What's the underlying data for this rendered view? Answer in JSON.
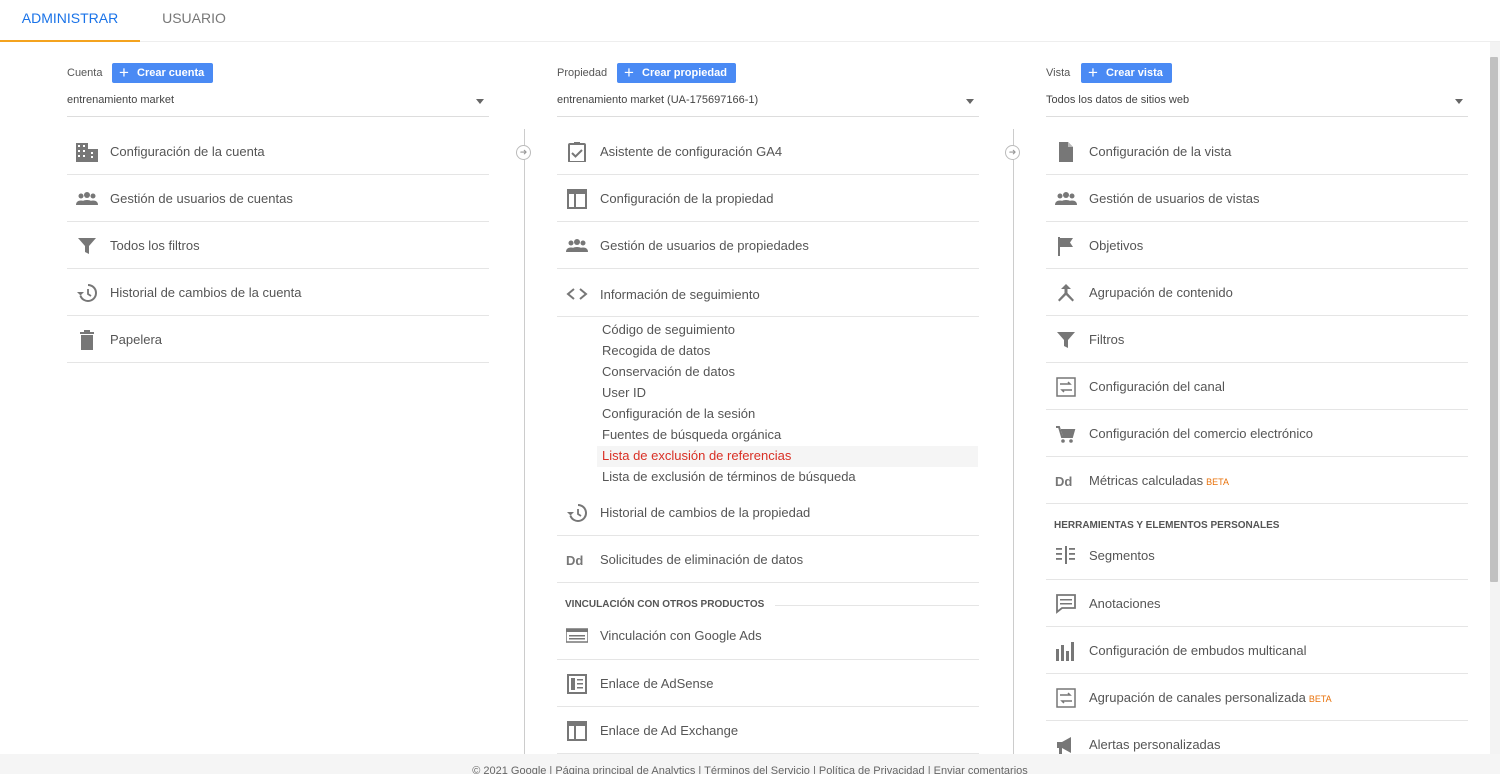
{
  "tabs": {
    "admin": "ADMINISTRAR",
    "user": "USUARIO"
  },
  "account": {
    "label": "Cuenta",
    "create": "Crear cuenta",
    "selected": "entrenamiento market",
    "items": [
      {
        "label": "Configuración de la cuenta",
        "icon": "building-icon"
      },
      {
        "label": "Gestión de usuarios de cuentas",
        "icon": "people-icon"
      },
      {
        "label": "Todos los filtros",
        "icon": "filter-icon"
      },
      {
        "label": "Historial de cambios de la cuenta",
        "icon": "history-icon"
      },
      {
        "label": "Papelera",
        "icon": "trash-icon"
      }
    ]
  },
  "property": {
    "label": "Propiedad",
    "create": "Crear propiedad",
    "selected": "entrenamiento market (UA-175697166-1)",
    "items": [
      {
        "label": "Asistente de configuración GA4",
        "icon": "clipboard-check-icon"
      },
      {
        "label": "Configuración de la propiedad",
        "icon": "window-icon"
      },
      {
        "label": "Gestión de usuarios de propiedades",
        "icon": "people-icon"
      },
      {
        "label": "Información de seguimiento",
        "icon": "code-icon"
      }
    ],
    "tracking_sub": [
      "Código de seguimiento",
      "Recogida de datos",
      "Conservación de datos",
      "User ID",
      "Configuración de la sesión",
      "Fuentes de búsqueda orgánica",
      "Lista de exclusión de referencias",
      "Lista de exclusión de términos de búsqueda"
    ],
    "items2": [
      {
        "label": "Historial de cambios de la propiedad",
        "icon": "history-icon"
      },
      {
        "label": "Solicitudes de eliminación de datos",
        "icon": "dd-icon"
      }
    ],
    "section": "VINCULACIÓN CON OTROS PRODUCTOS",
    "links": [
      {
        "label": "Vinculación con Google Ads",
        "icon": "ads-icon"
      },
      {
        "label": "Enlace de AdSense",
        "icon": "adsense-icon"
      },
      {
        "label": "Enlace de Ad Exchange",
        "icon": "window-icon"
      }
    ]
  },
  "view": {
    "label": "Vista",
    "create": "Crear vista",
    "selected": "Todos los datos de sitios web",
    "items": [
      {
        "label": "Configuración de la vista",
        "icon": "document-icon"
      },
      {
        "label": "Gestión de usuarios de vistas",
        "icon": "people-icon"
      },
      {
        "label": "Objetivos",
        "icon": "flag-icon"
      },
      {
        "label": "Agrupación de contenido",
        "icon": "merge-icon"
      },
      {
        "label": "Filtros",
        "icon": "filter-icon"
      },
      {
        "label": "Configuración del canal",
        "icon": "channel-icon"
      },
      {
        "label": "Configuración del comercio electrónico",
        "icon": "cart-icon"
      },
      {
        "label": "Métricas calculadas",
        "icon": "dd-icon",
        "badge": "BETA"
      }
    ],
    "section": "HERRAMIENTAS Y ELEMENTOS PERSONALES",
    "tools": [
      {
        "label": "Segmentos",
        "icon": "segments-icon"
      },
      {
        "label": "Anotaciones",
        "icon": "comment-icon"
      },
      {
        "label": "Configuración de embudos multicanal",
        "icon": "bar-chart-icon"
      },
      {
        "label": "Agrupación de canales personalizada",
        "icon": "channel-icon",
        "badge": "BETA"
      },
      {
        "label": "Alertas personalizadas",
        "icon": "megaphone-icon"
      }
    ]
  },
  "footer": "© 2021 Google | Página principal de Analytics | Términos del Servicio | Política de Privacidad | Enviar comentarios"
}
